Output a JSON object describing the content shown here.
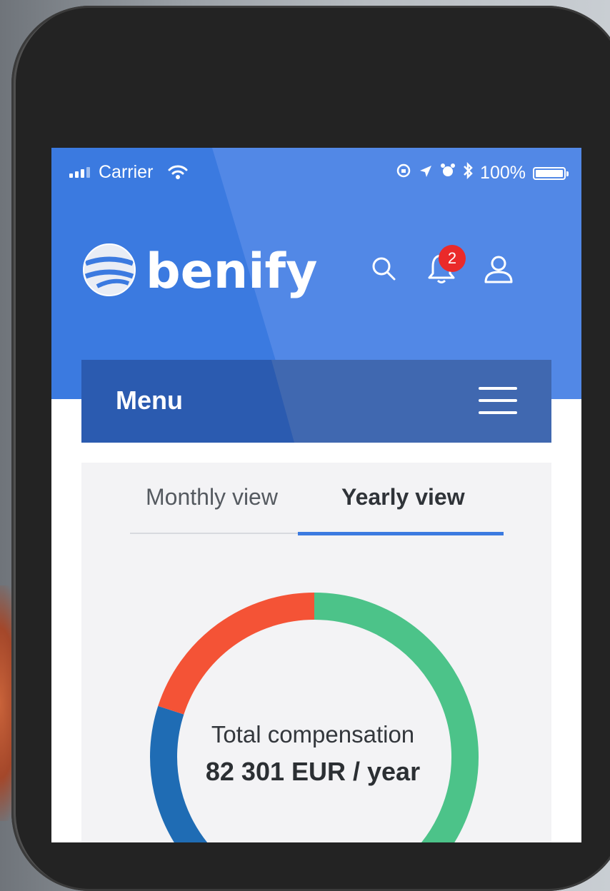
{
  "status_bar": {
    "carrier": "Carrier",
    "battery": "100%"
  },
  "header": {
    "brand": "benify",
    "notification_count": "2",
    "icons": [
      "globe-logo-icon",
      "search-icon",
      "bell-icon",
      "user-icon"
    ]
  },
  "menu": {
    "label": "Menu",
    "icon": "hamburger-icon"
  },
  "tabs": [
    {
      "label": "Monthly view",
      "active": false
    },
    {
      "label": "Yearly view",
      "active": true
    }
  ],
  "summary": {
    "label": "Total compensation",
    "value": "82 301 EUR / year"
  },
  "chart_data": {
    "type": "pie",
    "series": [
      {
        "color": "#4cc389",
        "fraction": 0.63
      },
      {
        "color": "#1f6cb4",
        "fraction": 0.17
      },
      {
        "color": "#f45336",
        "fraction": 0.2
      }
    ]
  },
  "colors": {
    "brand_blue": "#3b7ae0",
    "menu_blue": "#2b5bb0",
    "badge_red": "#ea2a2a"
  }
}
